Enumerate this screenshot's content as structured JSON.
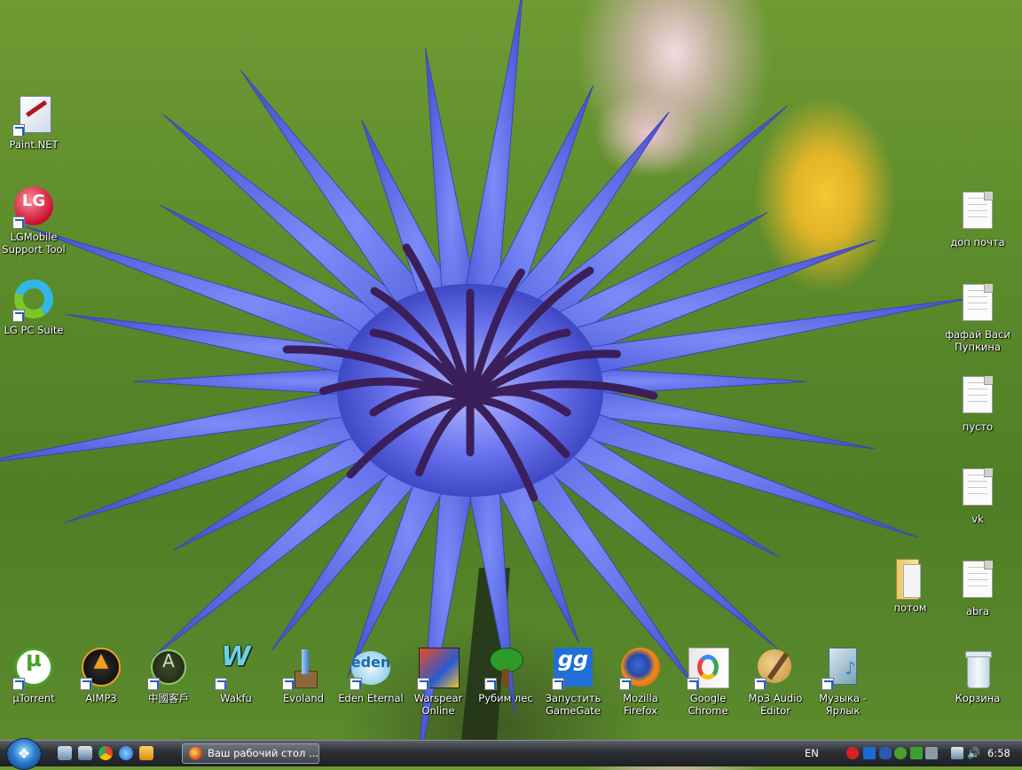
{
  "desktop": {
    "left_icons": [
      {
        "id": "paint-net",
        "label": "Paint.NET",
        "icon": "paint-net-icon"
      },
      {
        "id": "lgmobile",
        "label": "LGMobile Support Tool",
        "icon": "lg-icon"
      },
      {
        "id": "lgpcsuite",
        "label": "LG PC Suite",
        "icon": "lg-pc-suite-icon"
      }
    ],
    "right_icons": [
      {
        "id": "dop-pochta",
        "label": "доп почта",
        "icon": "text-file-icon"
      },
      {
        "id": "fafay",
        "label": "фафай Васи Пупкина",
        "icon": "text-file-icon"
      },
      {
        "id": "pusto",
        "label": "пусто",
        "icon": "text-file-icon"
      },
      {
        "id": "vk",
        "label": "vk",
        "icon": "text-file-icon"
      },
      {
        "id": "abra",
        "label": "abra",
        "icon": "text-file-icon"
      },
      {
        "id": "potom",
        "label": "потом",
        "icon": "folder-icon"
      },
      {
        "id": "korzina",
        "label": "Корзина",
        "icon": "recycle-bin-icon"
      }
    ],
    "bottom_icons": [
      {
        "id": "utorrent",
        "label": "µTorrent",
        "icon": "utorrent-icon"
      },
      {
        "id": "aimp3",
        "label": "AIMP3",
        "icon": "aimp-icon"
      },
      {
        "id": "zhongguo",
        "label": "中國客戶",
        "icon": "client-icon"
      },
      {
        "id": "wakfu",
        "label": "Wakfu",
        "icon": "wakfu-icon"
      },
      {
        "id": "evoland",
        "label": "Evoland",
        "icon": "evoland-icon"
      },
      {
        "id": "eden",
        "label": "Eden Eternal",
        "icon": "eden-eternal-icon"
      },
      {
        "id": "warspear",
        "label": "Warspear Online",
        "icon": "warspear-icon"
      },
      {
        "id": "rubim",
        "label": "Рубим лес",
        "icon": "tree-icon"
      },
      {
        "id": "gamegate",
        "label": "Запустить GameGate",
        "icon": "gamegate-icon"
      },
      {
        "id": "firefox",
        "label": "Mozilla Firefox",
        "icon": "firefox-icon"
      },
      {
        "id": "chrome",
        "label": "Google Chrome",
        "icon": "chrome-icon"
      },
      {
        "id": "mp3editor",
        "label": "Mp3 Audio Editor",
        "icon": "audio-editor-icon"
      },
      {
        "id": "muzyka",
        "label": "Музыка - Ярлык",
        "icon": "music-shortcut-icon"
      }
    ]
  },
  "taskbar": {
    "window_title": "Ваш рабочий стол ...",
    "language": "EN",
    "clock": "6:58"
  }
}
